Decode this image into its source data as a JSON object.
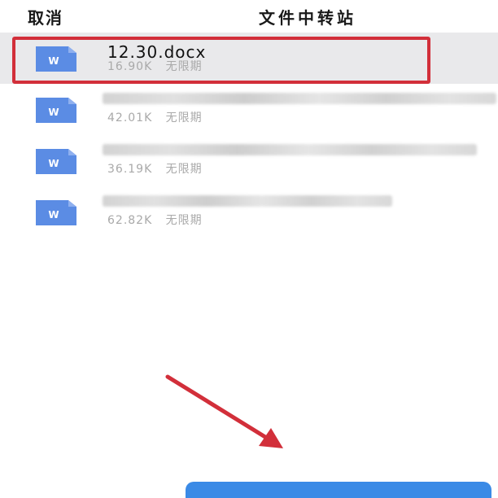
{
  "header": {
    "cancel_label": "取消",
    "title": "文件中转站"
  },
  "files": [
    {
      "name": "12.30.docx",
      "size": "16.90K",
      "expiry": "无限期",
      "selected": true,
      "icon": "word-file-icon"
    },
    {
      "name": "",
      "size": "42.01K",
      "expiry": "无限期",
      "selected": false,
      "icon": "word-file-icon"
    },
    {
      "name": "",
      "size": "36.19K",
      "expiry": "无限期",
      "selected": false,
      "icon": "word-file-icon"
    },
    {
      "name": "",
      "size": "62.82K",
      "expiry": "无限期",
      "selected": false,
      "icon": "word-file-icon"
    }
  ],
  "colors": {
    "highlight": "#d22f3a",
    "icon_fill": "#5b8ce4",
    "button": "#3a8ae6",
    "selected_row": "#e9e9eb"
  }
}
